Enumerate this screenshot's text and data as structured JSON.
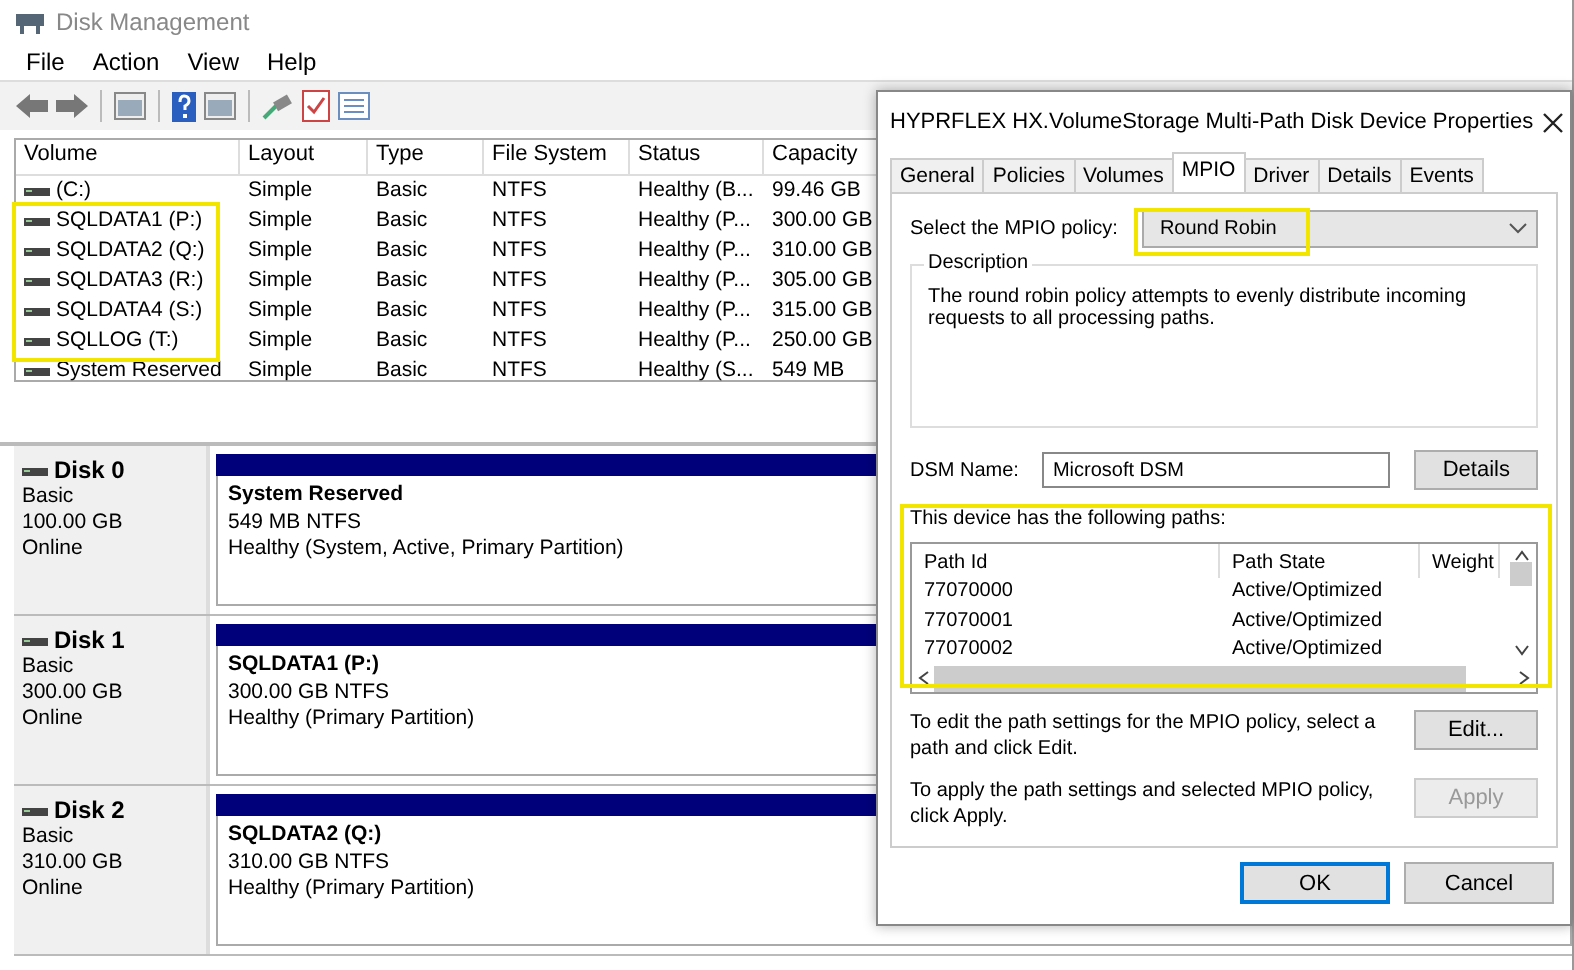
{
  "window": {
    "title": "Disk Management"
  },
  "menu": [
    "File",
    "Action",
    "View",
    "Help"
  ],
  "volume_table": {
    "columns": [
      "Volume",
      "Layout",
      "Type",
      "File System",
      "Status",
      "Capacity"
    ],
    "rows": [
      {
        "cells": [
          "(C:)",
          "Simple",
          "Basic",
          "NTFS",
          "Healthy (B...",
          "99.46 GB"
        ],
        "highlighted": false
      },
      {
        "cells": [
          "SQLDATA1 (P:)",
          "Simple",
          "Basic",
          "NTFS",
          "Healthy (P...",
          "300.00 GB"
        ],
        "highlighted": true
      },
      {
        "cells": [
          "SQLDATA2 (Q:)",
          "Simple",
          "Basic",
          "NTFS",
          "Healthy (P...",
          "310.00 GB"
        ],
        "highlighted": true
      },
      {
        "cells": [
          "SQLDATA3 (R:)",
          "Simple",
          "Basic",
          "NTFS",
          "Healthy (P...",
          "305.00 GB"
        ],
        "highlighted": true
      },
      {
        "cells": [
          "SQLDATA4 (S:)",
          "Simple",
          "Basic",
          "NTFS",
          "Healthy (P...",
          "315.00 GB"
        ],
        "highlighted": true
      },
      {
        "cells": [
          "SQLLOG (T:)",
          "Simple",
          "Basic",
          "NTFS",
          "Healthy (P...",
          "250.00 GB"
        ],
        "highlighted": true
      },
      {
        "cells": [
          "System Reserved",
          "Simple",
          "Basic",
          "NTFS",
          "Healthy (S...",
          "549 MB"
        ],
        "highlighted": false
      }
    ]
  },
  "disks": [
    {
      "name": "Disk 0",
      "type": "Basic",
      "size": "100.00 GB",
      "state": "Online",
      "partition": {
        "name": "System Reserved",
        "size": "549 MB NTFS",
        "status": "Healthy (System, Active, Primary Partition)"
      }
    },
    {
      "name": "Disk 1",
      "type": "Basic",
      "size": "300.00 GB",
      "state": "Online",
      "partition": {
        "name": "SQLDATA1  (P:)",
        "size": "300.00 GB NTFS",
        "status": "Healthy (Primary Partition)"
      }
    },
    {
      "name": "Disk 2",
      "type": "Basic",
      "size": "310.00 GB",
      "state": "Online",
      "partition": {
        "name": "SQLDATA2  (Q:)",
        "size": "310.00 GB NTFS",
        "status": "Healthy (Primary Partition)"
      }
    }
  ],
  "dialog": {
    "title": "HYPRFLEX HX.VolumeStorage  Multi-Path Disk Device Properties",
    "tabs": [
      {
        "label": "General",
        "selected": false
      },
      {
        "label": "Policies",
        "selected": false
      },
      {
        "label": "Volumes",
        "selected": false
      },
      {
        "label": "MPIO",
        "selected": true
      },
      {
        "label": "Driver",
        "selected": false
      },
      {
        "label": "Details",
        "selected": false
      },
      {
        "label": "Events",
        "selected": false
      }
    ],
    "policy_label": "Select the MPIO policy:",
    "policy_value": "Round Robin",
    "policy_highlighted": true,
    "description_title": "Description",
    "description": "The round robin policy attempts to evenly distribute incoming requests to all processing paths.",
    "dsm_label": "DSM Name:",
    "dsm_value": "Microsoft DSM",
    "details_button": "Details",
    "paths_label": "This device has the following paths:",
    "paths_highlighted": true,
    "paths_columns": [
      "Path Id",
      "Path State",
      "Weight"
    ],
    "paths": [
      {
        "id": "77070000",
        "state": "Active/Optimized"
      },
      {
        "id": "77070001",
        "state": "Active/Optimized"
      },
      {
        "id": "77070002",
        "state": "Active/Optimized"
      }
    ],
    "edit_text": "To edit the path settings for the MPIO policy, select a path and click Edit.",
    "edit_button": {
      "label": "Edit...",
      "disabled": false
    },
    "apply_text": "To apply the path settings and selected MPIO policy, click Apply.",
    "apply_button": {
      "label": "Apply",
      "disabled": true
    },
    "buttons": [
      {
        "label": "OK",
        "default": true
      },
      {
        "label": "Cancel",
        "default": false
      }
    ]
  }
}
